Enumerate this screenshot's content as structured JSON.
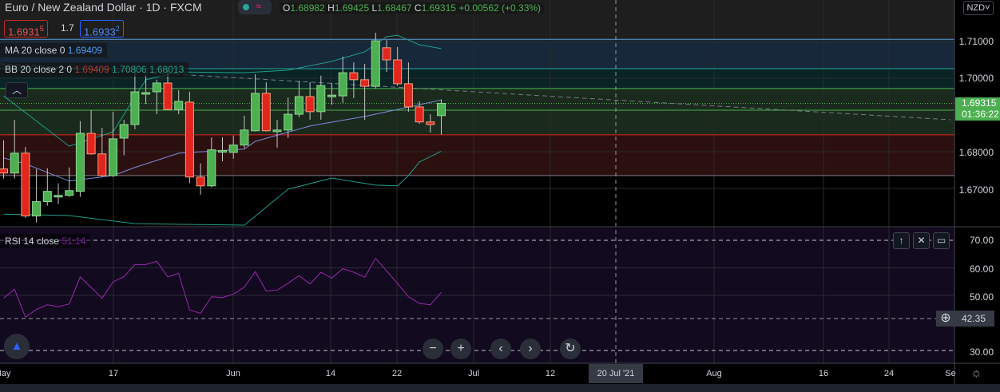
{
  "header": {
    "title": "Euro / New Zealand Dollar · 1D · FXCM",
    "open_label": "O",
    "open": "1.68982",
    "high_label": "H",
    "high": "1.69425",
    "low_label": "L",
    "low": "1.68467",
    "close_label": "C",
    "close": "1.69315",
    "change": "+0.00562 (+0.33%)"
  },
  "trade": {
    "sell": "1.6931",
    "sell_sup": "5",
    "spread": "1.7",
    "buy": "1.6933",
    "buy_sup": "2"
  },
  "legend": {
    "ma_label": "MA 20 close 0",
    "ma_value": "1.69409",
    "bb_label": "BB 20 close 2 0",
    "bb_basis": "1.69409",
    "bb_upper": "1.70806",
    "bb_lower": "1.68013",
    "rsi_label": "RSI 14 close",
    "rsi_value": "51.14",
    "collapse_icon": "chevron-up"
  },
  "price_axis": {
    "currency": "NZD",
    "labels": [
      "1.71000",
      "1.70000",
      "1.68000",
      "1.67000"
    ],
    "last_price": "1.69315",
    "countdown": "01:36:22"
  },
  "rsi_axis": {
    "labels": [
      "70.00",
      "60.00",
      "50.00",
      "30.00"
    ],
    "crosshair_value": "42.35"
  },
  "time_axis": {
    "labels": [
      "May",
      "17",
      "Jun",
      "14",
      "22",
      "Jul",
      "12",
      "Aug",
      "16",
      "24",
      "Se"
    ],
    "crosshair": "20 Jul '21"
  },
  "colors": {
    "up": "#4caf50",
    "down": "#e0261d",
    "ma": "#7b8ce0",
    "bb": "#1f9e8a",
    "rsi": "#9c27b0"
  },
  "chart_data": {
    "type": "candlestick",
    "candles": [
      [
        1.6753,
        1.6831,
        1.6727,
        1.6742
      ],
      [
        1.6742,
        1.6887,
        1.6727,
        1.6796
      ],
      [
        1.6796,
        1.6813,
        1.662,
        1.6625
      ],
      [
        1.6625,
        1.6753,
        1.6607,
        1.6664
      ],
      [
        1.6664,
        1.6755,
        1.6653,
        1.6692
      ],
      [
        1.6679,
        1.6714,
        1.6657,
        1.6681
      ],
      [
        1.6681,
        1.6757,
        1.6677,
        1.6694
      ],
      [
        1.6692,
        1.6883,
        1.6677,
        1.685
      ],
      [
        1.685,
        1.6913,
        1.6792,
        1.6794
      ],
      [
        1.6794,
        1.6865,
        1.6731,
        1.6735
      ],
      [
        1.6735,
        1.6909,
        1.6731,
        1.6835
      ],
      [
        1.6837,
        1.6887,
        1.679,
        1.6874
      ],
      [
        1.6874,
        1.7035,
        1.6861,
        1.6963
      ],
      [
        1.6961,
        1.7011,
        1.693,
        1.6961
      ],
      [
        1.6963,
        1.6996,
        1.6902,
        1.6987
      ],
      [
        1.6987,
        1.7022,
        1.6913,
        1.6915
      ],
      [
        1.6915,
        1.6967,
        1.6902,
        1.6937
      ],
      [
        1.6935,
        1.6963,
        1.6714,
        1.6731
      ],
      [
        1.6731,
        1.6768,
        1.6683,
        1.6707
      ],
      [
        1.6707,
        1.6839,
        1.6703,
        1.6805
      ],
      [
        1.68,
        1.6839,
        1.6774,
        1.6803
      ],
      [
        1.6798,
        1.6844,
        1.6781,
        1.6818
      ],
      [
        1.6818,
        1.6898,
        1.6809,
        1.6859
      ],
      [
        1.6857,
        1.7011,
        1.6855,
        1.6959
      ],
      [
        1.6959,
        1.6989,
        1.6855,
        1.6857
      ],
      [
        1.6857,
        1.6887,
        1.6811,
        1.6859
      ],
      [
        1.6859,
        1.6948,
        1.6837,
        1.6902
      ],
      [
        1.6902,
        1.6993,
        1.6894,
        1.695
      ],
      [
        1.695,
        1.6989,
        1.6887,
        1.6909
      ],
      [
        1.6909,
        1.7007,
        1.6887,
        1.698
      ],
      [
        1.6952,
        1.6987,
        1.6928,
        1.6954
      ],
      [
        1.6952,
        1.7059,
        1.6933,
        1.7015
      ],
      [
        1.7015,
        1.7043,
        1.6946,
        1.6996
      ],
      [
        1.6996,
        1.7039,
        1.6887,
        1.6978
      ],
      [
        1.6978,
        1.7124,
        1.6972,
        1.7102
      ],
      [
        1.7083,
        1.7104,
        1.7017,
        1.705
      ],
      [
        1.705,
        1.7085,
        1.698,
        1.6985
      ],
      [
        1.6985,
        1.7043,
        1.6909,
        1.6922
      ],
      [
        1.6922,
        1.6937,
        1.6876,
        1.6881
      ],
      [
        1.6881,
        1.6902,
        1.6852,
        1.6874
      ],
      [
        1.68982,
        1.69425,
        1.68467,
        1.69315
      ]
    ],
    "bb_upper": [
      [
        0,
        1.6952
      ],
      [
        6,
        1.6815
      ],
      [
        10,
        1.6854
      ],
      [
        13,
        1.6996
      ],
      [
        16,
        1.7017
      ],
      [
        22,
        1.7015
      ],
      [
        26,
        1.7022
      ],
      [
        30,
        1.7046
      ],
      [
        33,
        1.7072
      ],
      [
        35,
        1.7113
      ],
      [
        36,
        1.7117
      ],
      [
        38,
        1.7091
      ],
      [
        40,
        1.70806
      ]
    ],
    "bb_lower": [
      [
        0,
        1.663
      ],
      [
        6,
        1.6626
      ],
      [
        12,
        1.6604
      ],
      [
        22,
        1.66
      ],
      [
        26,
        1.6698
      ],
      [
        30,
        1.6728
      ],
      [
        34,
        1.6709
      ],
      [
        36,
        1.6707
      ],
      [
        37,
        1.6735
      ],
      [
        38,
        1.6772
      ],
      [
        40,
        1.68013
      ]
    ],
    "ma": [
      [
        0,
        1.6783
      ],
      [
        2,
        1.6767
      ],
      [
        6,
        1.672
      ],
      [
        10,
        1.6735
      ],
      [
        12,
        1.6757
      ],
      [
        16,
        1.6796
      ],
      [
        22,
        1.6807
      ],
      [
        23,
        1.6828
      ],
      [
        28,
        1.687
      ],
      [
        33,
        1.6896
      ],
      [
        36,
        1.6915
      ],
      [
        40,
        1.69409
      ]
    ],
    "rsi": [
      49.0,
      52.2,
      42.1,
      44.9,
      46.6,
      45.9,
      46.9,
      56.7,
      52.9,
      49.0,
      54.9,
      56.8,
      61.2,
      61.2,
      62.4,
      56.7,
      58.0,
      44.7,
      43.5,
      49.5,
      49.2,
      50.5,
      53.0,
      58.6,
      51.6,
      51.9,
      54.4,
      57.2,
      54.1,
      58.4,
      56.3,
      59.7,
      58.4,
      56.6,
      63.5,
      58.9,
      54.3,
      49.5,
      47.1,
      46.6,
      51.14
    ],
    "rsi_levels": [
      70,
      30
    ],
    "ylim": [
      1.66,
      1.715
    ],
    "zones": [
      {
        "from": 1.7106,
        "to": 1.7026,
        "color": "#16283a"
      },
      {
        "from": 1.7026,
        "to": 1.6972,
        "color": "#0a2426"
      },
      {
        "from": 1.6972,
        "to": 1.6846,
        "color": "#1a2a1c"
      },
      {
        "from": 1.6846,
        "to": 1.6735,
        "color": "#2c1010"
      }
    ]
  }
}
